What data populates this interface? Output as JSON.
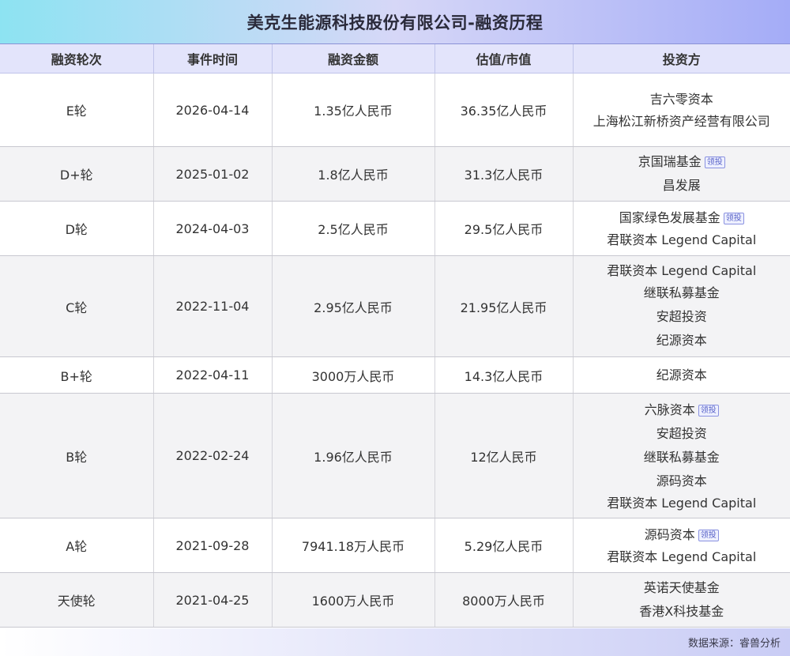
{
  "title": "美克生能源科技股份有限公司-融资历程",
  "headers": [
    "融资轮次",
    "事件时间",
    "融资金额",
    "估值/市值",
    "投资方"
  ],
  "lead_label": "领投",
  "rows": [
    {
      "round": "E轮",
      "date": "2026-04-14",
      "amount": "1.35亿人民币",
      "valuation": "36.35亿人民币",
      "investors": [
        {
          "name": "吉六零资本",
          "lead": false
        },
        {
          "name": "上海松江新桥资产经营有限公司",
          "lead": false
        }
      ]
    },
    {
      "round": "D+轮",
      "date": "2025-01-02",
      "amount": "1.8亿人民币",
      "valuation": "31.3亿人民币",
      "investors": [
        {
          "name": "京国瑞基金",
          "lead": true
        },
        {
          "name": "昌发展",
          "lead": false
        }
      ]
    },
    {
      "round": "D轮",
      "date": "2024-04-03",
      "amount": "2.5亿人民币",
      "valuation": "29.5亿人民币",
      "investors": [
        {
          "name": "国家绿色发展基金",
          "lead": true
        },
        {
          "name": "君联资本 Legend Capital",
          "lead": false
        }
      ]
    },
    {
      "round": "C轮",
      "date": "2022-11-04",
      "amount": "2.95亿人民币",
      "valuation": "21.95亿人民币",
      "investors": [
        {
          "name": "君联资本 Legend Capital",
          "lead": false
        },
        {
          "name": "继联私募基金",
          "lead": false
        },
        {
          "name": "安超投资",
          "lead": false
        },
        {
          "name": "纪源资本",
          "lead": false
        }
      ]
    },
    {
      "round": "B+轮",
      "date": "2022-04-11",
      "amount": "3000万人民币",
      "valuation": "14.3亿人民币",
      "investors": [
        {
          "name": "纪源资本",
          "lead": false
        }
      ]
    },
    {
      "round": "B轮",
      "date": "2022-02-24",
      "amount": "1.96亿人民币",
      "valuation": "12亿人民币",
      "investors": [
        {
          "name": "六脉资本",
          "lead": true
        },
        {
          "name": "安超投资",
          "lead": false
        },
        {
          "name": "继联私募基金",
          "lead": false
        },
        {
          "name": "源码资本",
          "lead": false
        },
        {
          "name": "君联资本 Legend Capital",
          "lead": false
        }
      ]
    },
    {
      "round": "A轮",
      "date": "2021-09-28",
      "amount": "7941.18万人民币",
      "valuation": "5.29亿人民币",
      "investors": [
        {
          "name": "源码资本",
          "lead": true
        },
        {
          "name": "君联资本 Legend Capital",
          "lead": false
        }
      ]
    },
    {
      "round": "天使轮",
      "date": "2021-04-25",
      "amount": "1600万人民币",
      "valuation": "8000万人民币",
      "investors": [
        {
          "name": "英诺天使基金",
          "lead": false
        },
        {
          "name": "香港X科技基金",
          "lead": false
        }
      ]
    }
  ],
  "footer": {
    "source": "数据来源：睿兽分析"
  }
}
